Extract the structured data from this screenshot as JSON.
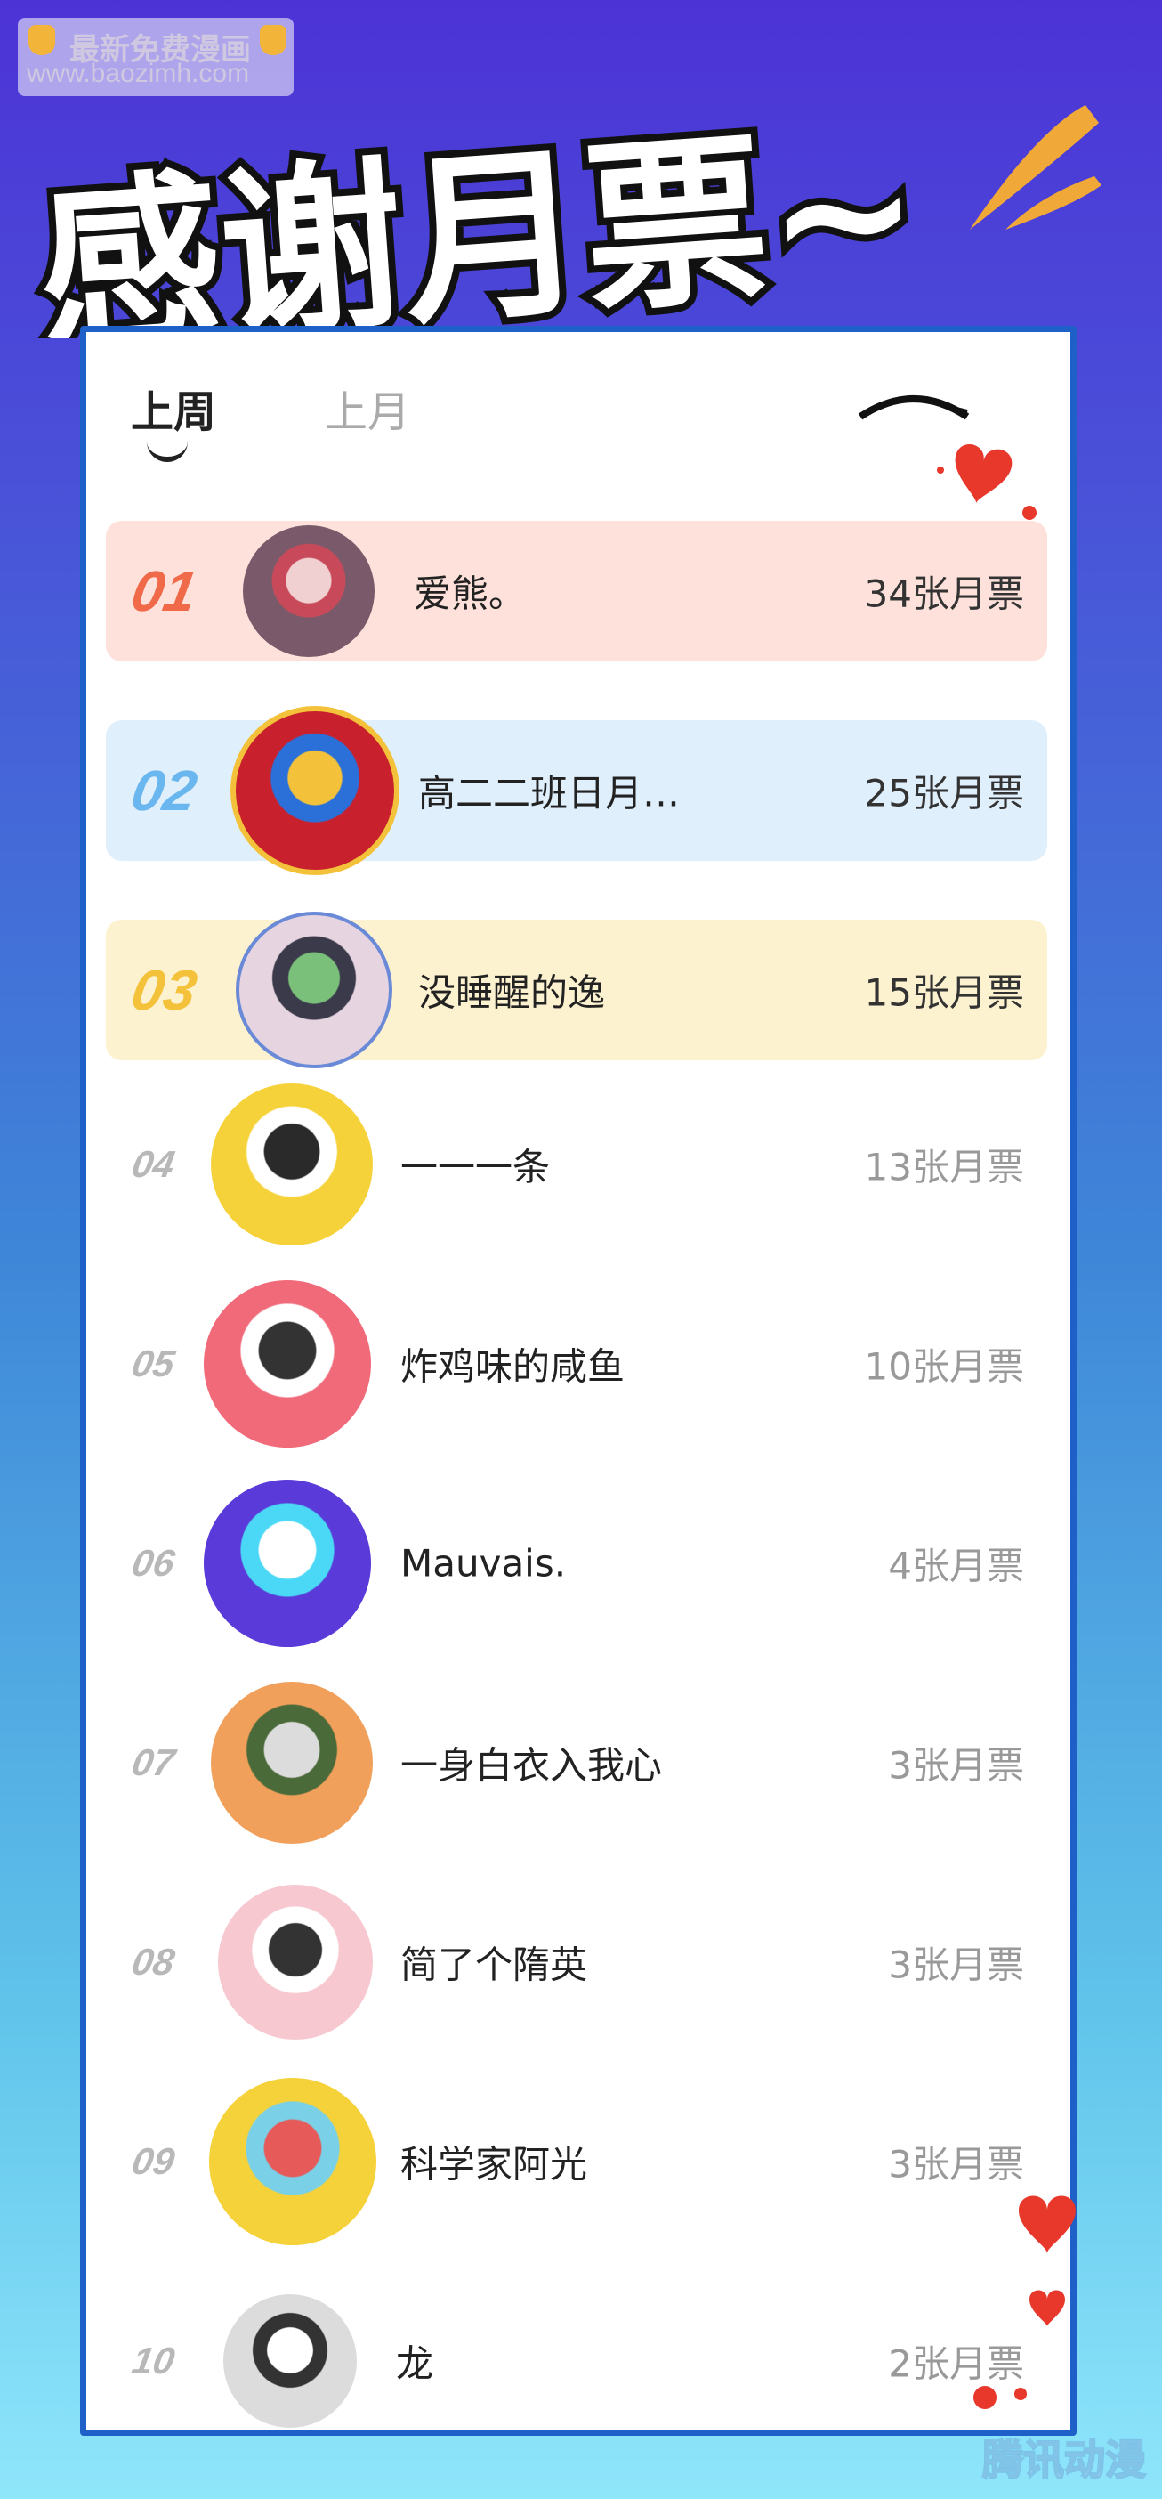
{
  "watermark": {
    "line1": "最新免费漫画",
    "line2": "www.baozimh.com"
  },
  "banner": {
    "title": "感谢月票~"
  },
  "tabs": [
    {
      "label": "上周",
      "active": true
    },
    {
      "label": "上月",
      "active": false
    }
  ],
  "colors": {
    "card_border": "#1e60c8",
    "rank1_bg": "#fde1da",
    "rank1_fg": "#f06a4a",
    "rank2_bg": "#e0effc",
    "rank2_fg": "#6ab6ee",
    "rank3_bg": "#fdf2cf",
    "rank3_fg": "#f3c23a",
    "heart": "#e8372b"
  },
  "ranking": [
    {
      "rank": "01",
      "name": "爱熊。",
      "tickets": "34张月票",
      "avatar": "avatar-girl-red-icon"
    },
    {
      "rank": "02",
      "name": "高二二班日月…",
      "tickets": "25张月票",
      "avatar": "avatar-game-hero-icon"
    },
    {
      "rank": "03",
      "name": "没睡醒的逸",
      "tickets": "15张月票",
      "avatar": "avatar-girl-flowers-icon"
    },
    {
      "rank": "04",
      "name": "一一一条",
      "tickets": "13张月票",
      "avatar": "avatar-lemon-cartoon-icon"
    },
    {
      "rank": "05",
      "name": "炸鸡味的咸鱼",
      "tickets": "10张月票",
      "avatar": "avatar-cool-boy-icon"
    },
    {
      "rank": "06",
      "name": "Mauvais.",
      "tickets": "4张月票",
      "avatar": "avatar-headphones-icon"
    },
    {
      "rank": "07",
      "name": "一身白衣入我心",
      "tickets": "3张月票",
      "avatar": "avatar-anime-boy-icon"
    },
    {
      "rank": "08",
      "name": "简了个隋英",
      "tickets": "3张月票",
      "avatar": "avatar-pig-icon"
    },
    {
      "rank": "09",
      "name": "科学家阿光",
      "tickets": "3张月票",
      "avatar": "avatar-pikachu-icon"
    },
    {
      "rank": "10",
      "name": "龙",
      "tickets": "2张月票",
      "avatar": "avatar-boy-white-hair-icon"
    }
  ],
  "footer_watermark": "腾讯动漫"
}
